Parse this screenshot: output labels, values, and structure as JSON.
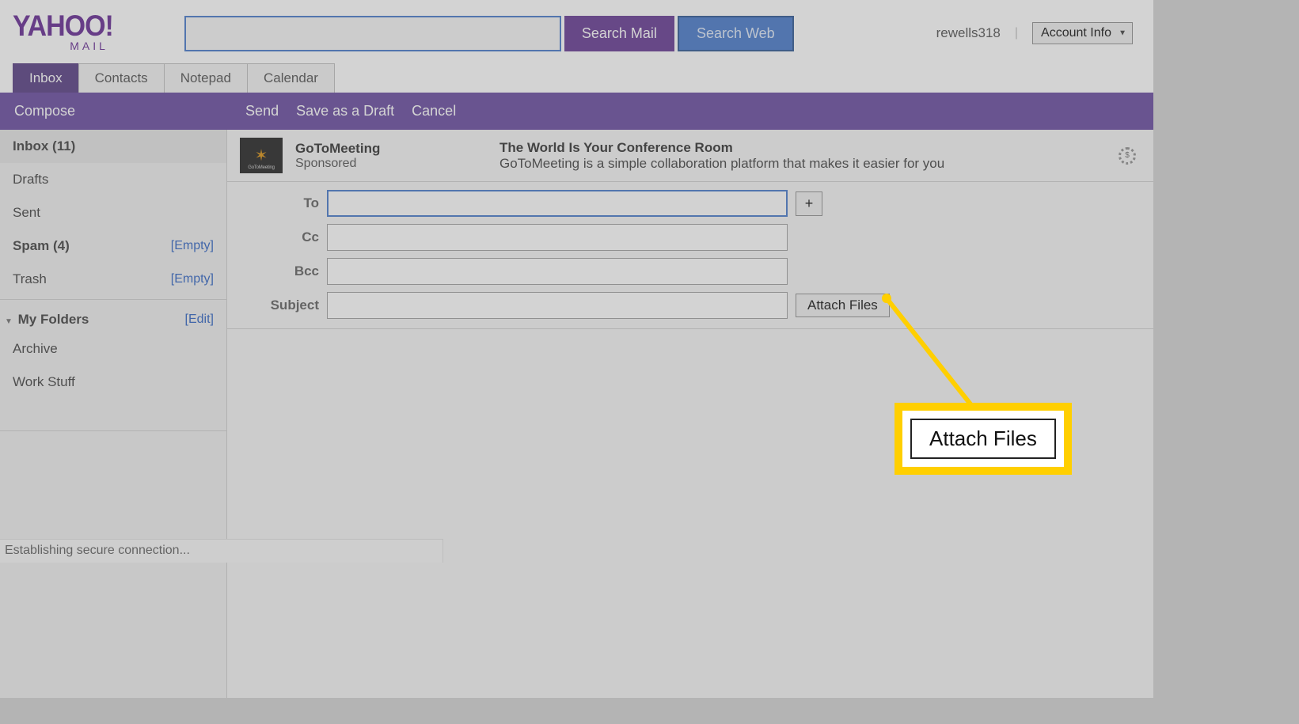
{
  "logo": {
    "top": "YAHOO!",
    "bottom": "MAIL"
  },
  "search": {
    "mail_btn": "Search Mail",
    "web_btn": "Search Web"
  },
  "user": {
    "name": "rewells318",
    "account_btn": "Account Info"
  },
  "tabs": {
    "inbox": "Inbox",
    "contacts": "Contacts",
    "notepad": "Notepad",
    "calendar": "Calendar"
  },
  "toolbar": {
    "compose": "Compose",
    "send": "Send",
    "save_draft": "Save as a Draft",
    "cancel": "Cancel"
  },
  "sidebar": {
    "inbox": "Inbox (11)",
    "drafts": "Drafts",
    "sent": "Sent",
    "spam": "Spam (4)",
    "spam_action": "[Empty]",
    "trash": "Trash",
    "trash_action": "[Empty]",
    "my_folders": "My Folders",
    "edit": "[Edit]",
    "archive": "Archive",
    "work_stuff": "Work Stuff"
  },
  "ad": {
    "brand": "GoToMeeting",
    "sponsored": "Sponsored",
    "headline": "The World Is Your Conference Room",
    "desc": "GoToMeeting is a simple collaboration platform that makes it easier for you",
    "star": "✶"
  },
  "compose": {
    "to_label": "To",
    "cc_label": "Cc",
    "bcc_label": "Bcc",
    "subject_label": "Subject",
    "plus": "+",
    "attach": "Attach Files"
  },
  "callout": {
    "text": "Attach Files"
  },
  "status": "Establishing secure connection..."
}
